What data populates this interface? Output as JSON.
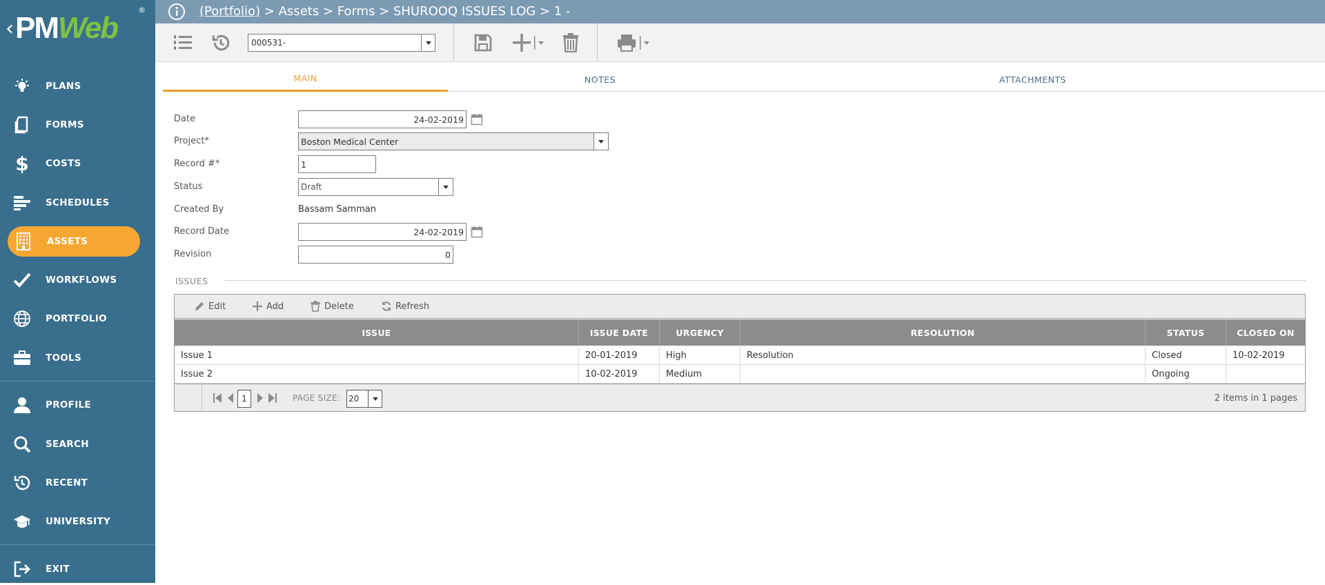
{
  "sidebar": {
    "logo": {
      "brand_pm": "PM",
      "brand_web": "Web",
      "registered": "®",
      "back": "‹"
    },
    "items": [
      {
        "label": "PLANS",
        "icon": "lightbulb-icon"
      },
      {
        "label": "FORMS",
        "icon": "document-icon"
      },
      {
        "label": "COSTS",
        "icon": "dollar-icon"
      },
      {
        "label": "SCHEDULES",
        "icon": "gantt-icon"
      },
      {
        "label": "ASSETS",
        "icon": "building-icon",
        "active": true
      },
      {
        "label": "WORKFLOWS",
        "icon": "checkmark-icon"
      },
      {
        "label": "PORTFOLIO",
        "icon": "globe-icon"
      },
      {
        "label": "TOOLS",
        "icon": "toolbox-icon"
      },
      {
        "label": "PROFILE",
        "icon": "user-icon"
      },
      {
        "label": "SEARCH",
        "icon": "search-icon"
      },
      {
        "label": "RECENT",
        "icon": "history-icon"
      },
      {
        "label": "UNIVERSITY",
        "icon": "graduation-cap-icon"
      },
      {
        "label": "EXIT",
        "icon": "exit-icon"
      }
    ]
  },
  "header": {
    "breadcrumb_link": "(Portfolio)",
    "breadcrumb_rest": " > Assets > Forms > SHUROOQ ISSUES LOG > 1 -"
  },
  "toolbar": {
    "record_select_value": "000531-"
  },
  "tabs": [
    {
      "label": "MAIN",
      "active": true
    },
    {
      "label": "NOTES"
    },
    {
      "label": "ATTACHMENTS"
    }
  ],
  "form": {
    "date_label": "Date",
    "date_value": "24-02-2019",
    "project_label": "Project*",
    "project_value": "Boston Medical Center",
    "record_label": "Record #*",
    "record_value": "1",
    "status_label": "Status",
    "status_value": "Draft",
    "created_by_label": "Created By",
    "created_by_value": "Bassam Samman",
    "record_date_label": "Record Date",
    "record_date_value": "24-02-2019",
    "revision_label": "Revision",
    "revision_value": "0"
  },
  "issues": {
    "section_title": "ISSUES",
    "toolbar": {
      "edit": "Edit",
      "add": "Add",
      "delete": "Delete",
      "refresh": "Refresh"
    },
    "columns": [
      "ISSUE",
      "ISSUE DATE",
      "URGENCY",
      "RESOLUTION",
      "STATUS",
      "CLOSED ON"
    ],
    "rows": [
      [
        "Issue 1",
        "20-01-2019",
        "High",
        "Resolution",
        "Closed",
        "10-02-2019"
      ],
      [
        "Issue 2",
        "10-02-2019",
        "Medium",
        "",
        "Ongoing",
        ""
      ]
    ],
    "pager": {
      "current_page": "1",
      "page_size_label": "PAGE SIZE:",
      "page_size_value": "20",
      "info": "2 items in 1 pages"
    }
  },
  "colors": {
    "sidebar": "#396e8d",
    "active_pill": "#f6a732",
    "topbar": "#7b9bb3",
    "tab_active": "#f29a2e",
    "grid_header": "#8c8c8c"
  }
}
